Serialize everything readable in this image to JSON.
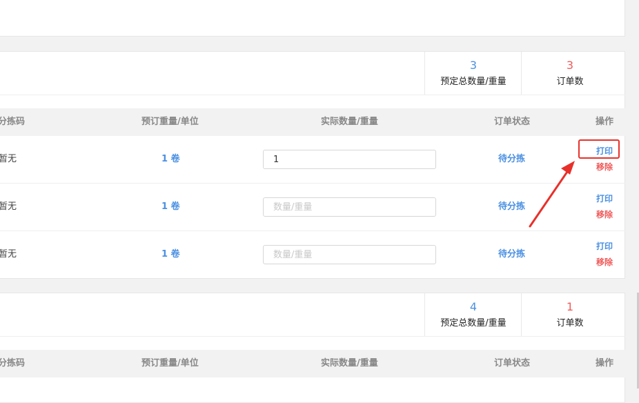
{
  "groups": [
    {
      "summary": {
        "total_value": "3",
        "total_label": "预定总数量/重量",
        "orders_value": "3",
        "orders_label": "订单数"
      },
      "columns": [
        "分拣码",
        "预订重量/单位",
        "实际数量/重量",
        "订单状态",
        "操作"
      ],
      "rows": [
        {
          "code": "暂无",
          "booked": "1 卷",
          "actual_value": "1",
          "actual_placeholder": "数量/重量",
          "status": "待分拣",
          "print_label": "打印",
          "remove_label": "移除"
        },
        {
          "code": "暂无",
          "booked": "1 卷",
          "actual_value": "",
          "actual_placeholder": "数量/重量",
          "status": "待分拣",
          "print_label": "打印",
          "remove_label": "移除"
        },
        {
          "code": "暂无",
          "booked": "1 卷",
          "actual_value": "",
          "actual_placeholder": "数量/重量",
          "status": "待分拣",
          "print_label": "打印",
          "remove_label": "移除"
        }
      ]
    },
    {
      "summary": {
        "total_value": "4",
        "total_label": "预定总数量/重量",
        "orders_value": "1",
        "orders_label": "订单数"
      },
      "columns": [
        "分拣码",
        "预订重量/单位",
        "实际数量/重量",
        "订单状态",
        "操作"
      ]
    }
  ],
  "annotation": {
    "color": "#e8302a",
    "icon": "arrow-icon"
  },
  "colors": {
    "accent_blue": "#4a90e2",
    "accent_red": "#f05a5a"
  }
}
